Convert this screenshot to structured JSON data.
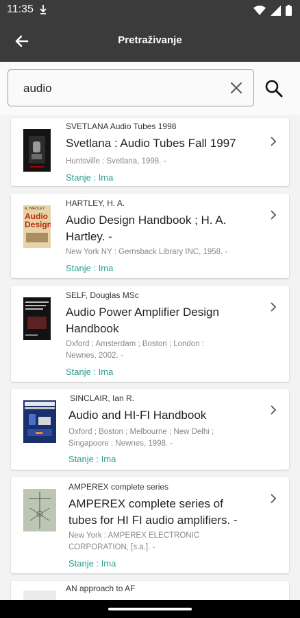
{
  "status": {
    "time": "11:35"
  },
  "appbar": {
    "title": "Pretraživanje"
  },
  "search": {
    "value": "audio"
  },
  "results": [
    {
      "author": "SVETLANA Audio Tubes 1998",
      "title": "Svetlana : Audio Tubes Fall 1997",
      "publisher": "Huntsville : Svetlana, 1998. -",
      "status": "Stanje : Ima"
    },
    {
      "author": "HARTLEY, H. A.",
      "title": "Audio Design Handbook ; H. A. Hartley. -",
      "publisher": "New York NY : Gernsback Library INC, 1958. -",
      "status": "Stanje : Ima"
    },
    {
      "author": "SELF, Douglas MSc",
      "title": "Audio Power Amplifier Design Handbook",
      "publisher": "Oxford ; Amsterdam ; Boston ; London : Newnes, 2002. -",
      "status": "Stanje : Ima"
    },
    {
      "author": "SINCLAIR, Ian R.",
      "title": "Audio and HI-FI Handbook",
      "publisher": "Oxford ; Boston ; Melbourne ; New Delhi ; Singapoore : Newnes, 1998. -",
      "status": "Stanje : Ima"
    },
    {
      "author": "AMPEREX complete series",
      "title": "AMPEREX complete series of tubes for HI FI audio amplifiers. -",
      "publisher": "New York : AMPEREX ELECTRONIC CORPORATION, [s.a.]. -",
      "status": "Stanje : Ima"
    },
    {
      "author": "AN approach to AF"
    }
  ],
  "covers": {
    "hartley_top": "A. HARTLEY",
    "hartley_big": "Audio Design"
  },
  "colors": {
    "bar": "#3b3b3b",
    "status_green": "#2a9d8f"
  }
}
